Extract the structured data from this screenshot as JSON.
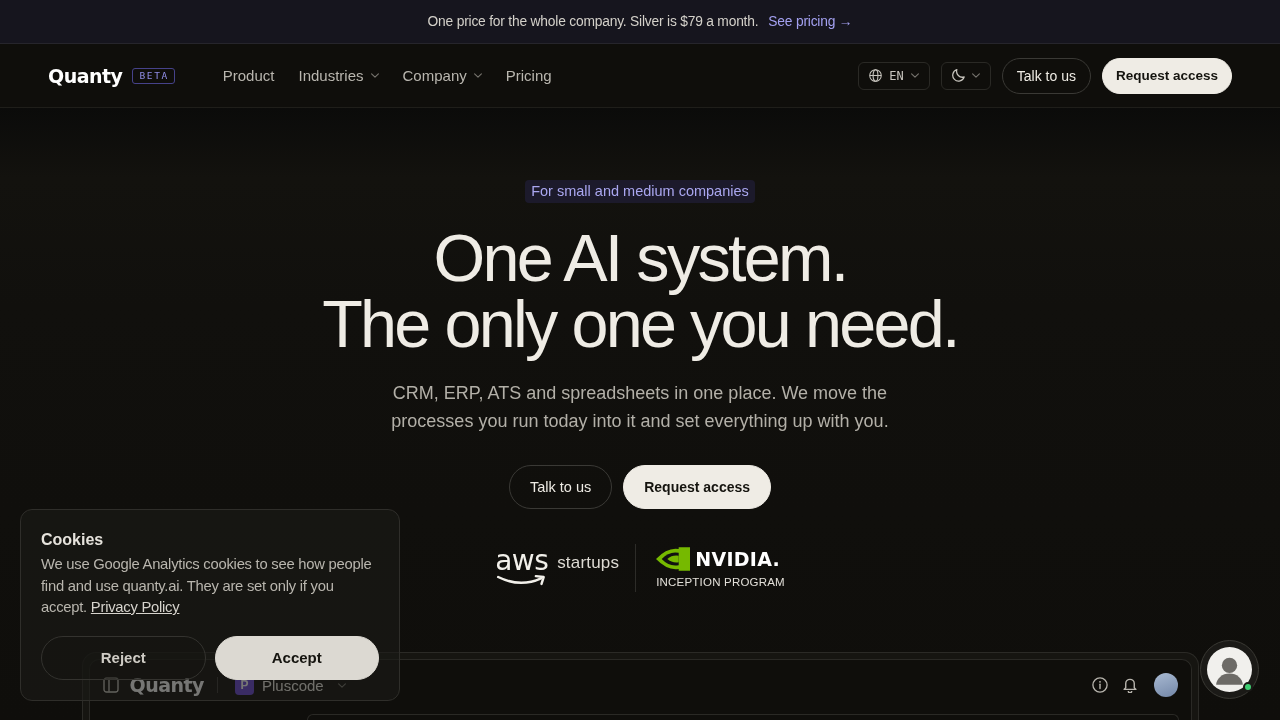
{
  "announcement": {
    "text": "One price for the whole company. Silver is $79 a month.",
    "link": "See pricing →"
  },
  "nav": {
    "logo": "Quanty",
    "badge": "BETA",
    "links": [
      {
        "label": "Product",
        "dropdown": false
      },
      {
        "label": "Industries",
        "dropdown": true
      },
      {
        "label": "Company",
        "dropdown": true
      },
      {
        "label": "Pricing",
        "dropdown": false
      }
    ],
    "language": "EN",
    "buttons": [
      {
        "label": "Talk to us",
        "kind": "outline"
      },
      {
        "label": "Request access",
        "kind": "primary"
      }
    ]
  },
  "hero": {
    "eyebrow": "For small and medium companies",
    "title": [
      "One AI system.",
      "The only one you need."
    ],
    "subtitle": "CRM, ERP, ATS and spreadsheets in one place. We move the processes you run today into it and set everything up with you.",
    "buttons": [
      {
        "label": "Talk to us",
        "kind": "outline"
      },
      {
        "label": "Request access",
        "kind": "primary"
      }
    ]
  },
  "partners": [
    {
      "kind": "aws",
      "wordmark": "aws",
      "label": "startups"
    },
    {
      "kind": "nvidia",
      "wordmark": "NVIDIA.",
      "label": "INCEPTION PROGRAM"
    }
  ],
  "app_preview": {
    "logo": "Quanty",
    "workspace_initial": "P",
    "workspace": "Pluscode"
  },
  "cookie_banner": {
    "title": "Cookies",
    "text": "We use Google Analytics cookies to see how people find and use quanty.ai. They are set only if you accept.",
    "link": "Privacy Policy",
    "buttons": [
      {
        "label": "Reject",
        "kind": "outline"
      },
      {
        "label": "Accept",
        "kind": "primary"
      }
    ]
  },
  "chat_widget": {
    "online": true
  }
}
